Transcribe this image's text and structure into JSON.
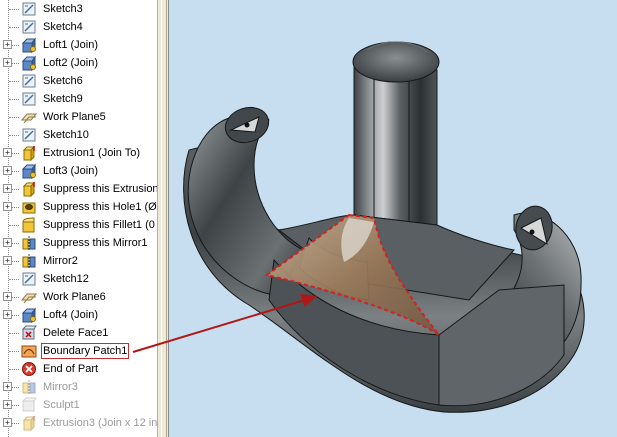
{
  "browser": {
    "items": [
      {
        "label": "Sketch3",
        "icon": "sketch-icon",
        "expander": null,
        "dim": false,
        "selected": false
      },
      {
        "label": "Sketch4",
        "icon": "sketch-icon",
        "expander": null,
        "dim": false,
        "selected": false
      },
      {
        "label": "Loft1 (Join)",
        "icon": "loft-icon",
        "expander": "+",
        "dim": false,
        "selected": false
      },
      {
        "label": "Loft2 (Join)",
        "icon": "loft-icon",
        "expander": "+",
        "dim": false,
        "selected": false
      },
      {
        "label": "Sketch6",
        "icon": "sketch-icon",
        "expander": null,
        "dim": false,
        "selected": false
      },
      {
        "label": "Sketch9",
        "icon": "sketch-icon",
        "expander": null,
        "dim": false,
        "selected": false
      },
      {
        "label": "Work Plane5",
        "icon": "work-plane-icon",
        "expander": null,
        "dim": false,
        "selected": false
      },
      {
        "label": "Sketch10",
        "icon": "sketch-icon",
        "expander": null,
        "dim": false,
        "selected": false
      },
      {
        "label": "Extrusion1 (Join To)",
        "icon": "extrusion-icon",
        "expander": "+",
        "dim": false,
        "selected": false
      },
      {
        "label": "Loft3 (Join)",
        "icon": "loft-icon",
        "expander": "+",
        "dim": false,
        "selected": false
      },
      {
        "label": "Suppress this Extrusion",
        "icon": "extrusion-icon",
        "expander": "+",
        "dim": false,
        "selected": false
      },
      {
        "label": "Suppress this Hole1 (Ø",
        "icon": "hole-icon",
        "expander": "+",
        "dim": false,
        "selected": false
      },
      {
        "label": "Suppress this Fillet1 (0",
        "icon": "fillet-icon",
        "expander": null,
        "dim": false,
        "selected": false
      },
      {
        "label": "Suppress this Mirror1",
        "icon": "mirror-icon",
        "expander": "+",
        "dim": false,
        "selected": false
      },
      {
        "label": "Mirror2",
        "icon": "mirror-icon",
        "expander": "+",
        "dim": false,
        "selected": false
      },
      {
        "label": "Sketch12",
        "icon": "sketch-icon",
        "expander": null,
        "dim": false,
        "selected": false
      },
      {
        "label": "Work Plane6",
        "icon": "work-plane-icon",
        "expander": "+",
        "dim": false,
        "selected": false
      },
      {
        "label": "Loft4 (Join)",
        "icon": "loft-icon",
        "expander": "+",
        "dim": false,
        "selected": false
      },
      {
        "label": "Delete Face1",
        "icon": "delete-face-icon",
        "expander": null,
        "dim": false,
        "selected": false
      },
      {
        "label": "Boundary Patch1",
        "icon": "boundary-patch-icon",
        "expander": null,
        "dim": false,
        "selected": true
      },
      {
        "label": "End of Part",
        "icon": "end-of-part-icon",
        "expander": null,
        "dim": false,
        "selected": false
      },
      {
        "label": "Mirror3",
        "icon": "mirror-icon",
        "expander": "+",
        "dim": true,
        "selected": false
      },
      {
        "label": "Sculpt1",
        "icon": "sculpt-icon",
        "expander": "+",
        "dim": true,
        "selected": false
      },
      {
        "label": "Extrusion3 (Join x 12 in",
        "icon": "extrusion-icon",
        "expander": "+",
        "dim": true,
        "selected": false
      }
    ]
  },
  "colors": {
    "viewport_background": "#c7ddf0",
    "highlight": "#d42020",
    "model_dark": "#2e3336",
    "model_light": "#a9adae"
  }
}
